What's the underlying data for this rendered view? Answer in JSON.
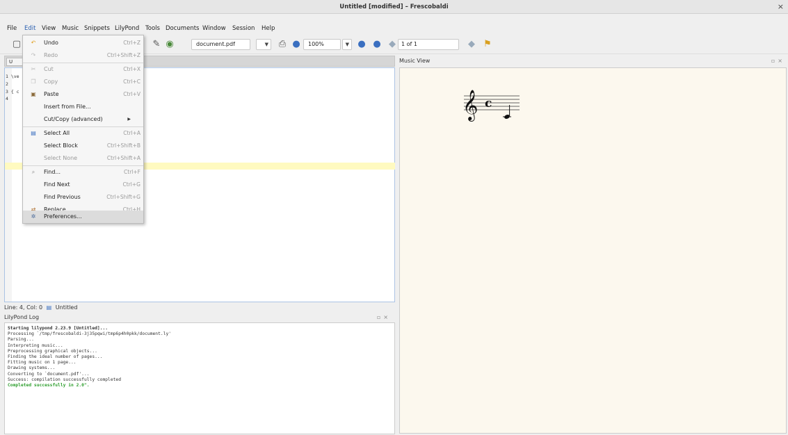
{
  "window": {
    "title": "Untitled [modified] – Frescobaldi",
    "close_glyph": "×"
  },
  "menubar": [
    "File",
    "Edit",
    "View",
    "Music",
    "Snippets",
    "LilyPond",
    "Tools",
    "Documents",
    "Window",
    "Session",
    "Help"
  ],
  "toolbar": {
    "document_combo": "document.pdf",
    "zoom_combo": "100%",
    "page_field": "1 of 1"
  },
  "editor": {
    "tab_label": "U",
    "lines": [
      "1 \\ve",
      "2",
      "3 { c",
      "4"
    ]
  },
  "statusbar": {
    "text": "Line: 4, Col: 0",
    "doc_name": "Untitled"
  },
  "log": {
    "title": "LilyPond Log",
    "lines": [
      "Starting lilypond 2.23.9 [Untitled]...",
      "Processing `/tmp/frescobaldi-3j35pqwi/tmp6p4h0pkk/document.ly'",
      "Parsing...",
      "Interpreting music...",
      "Preprocessing graphical objects...",
      "Finding the ideal number of pages...",
      "Fitting music on 1 page...",
      "Drawing systems...",
      "Converting to `document.pdf'...",
      "Success: compilation successfully completed",
      "Completed successfully in 2.0\"."
    ]
  },
  "music_view": {
    "title": "Music View",
    "clef_glyph": "𝄞",
    "time_glyph": "c"
  },
  "edit_menu": {
    "items": [
      {
        "label": "Undo",
        "shortcut": "Ctrl+Z",
        "icon": "undo-icon",
        "disabled": false
      },
      {
        "label": "Redo",
        "shortcut": "Ctrl+Shift+Z",
        "icon": "redo-icon",
        "disabled": true
      },
      {
        "label": "Cut",
        "shortcut": "Ctrl+X",
        "icon": "cut-icon",
        "disabled": true
      },
      {
        "label": "Copy",
        "shortcut": "Ctrl+C",
        "icon": "copy-icon",
        "disabled": true
      },
      {
        "label": "Paste",
        "shortcut": "Ctrl+V",
        "icon": "paste-icon",
        "disabled": false
      },
      {
        "label": "Insert from File...",
        "shortcut": "",
        "icon": "",
        "disabled": false
      },
      {
        "label": "Cut/Copy (advanced)",
        "shortcut": "",
        "icon": "",
        "disabled": false
      },
      {
        "label": "Select All",
        "shortcut": "Ctrl+A",
        "icon": "select-all-icon",
        "disabled": false
      },
      {
        "label": "Select Block",
        "shortcut": "Ctrl+Shift+B",
        "icon": "",
        "disabled": false
      },
      {
        "label": "Select None",
        "shortcut": "Ctrl+Shift+A",
        "icon": "",
        "disabled": true
      },
      {
        "label": "Find...",
        "shortcut": "Ctrl+F",
        "icon": "find-icon",
        "disabled": false
      },
      {
        "label": "Find Next",
        "shortcut": "Ctrl+G",
        "icon": "",
        "disabled": false
      },
      {
        "label": "Find Previous",
        "shortcut": "Ctrl+Shift+G",
        "icon": "",
        "disabled": false
      },
      {
        "label": "Replace...",
        "shortcut": "Ctrl+H",
        "icon": "replace-icon",
        "disabled": false
      },
      {
        "label": "Preferences...",
        "shortcut": "",
        "icon": "preferences-icon",
        "disabled": false
      }
    ]
  },
  "colors": {
    "accent": "#2a5fb0",
    "ok": "#2d9e2d",
    "music_bg": "#fcf8ee",
    "current_line": "#fffac0"
  }
}
